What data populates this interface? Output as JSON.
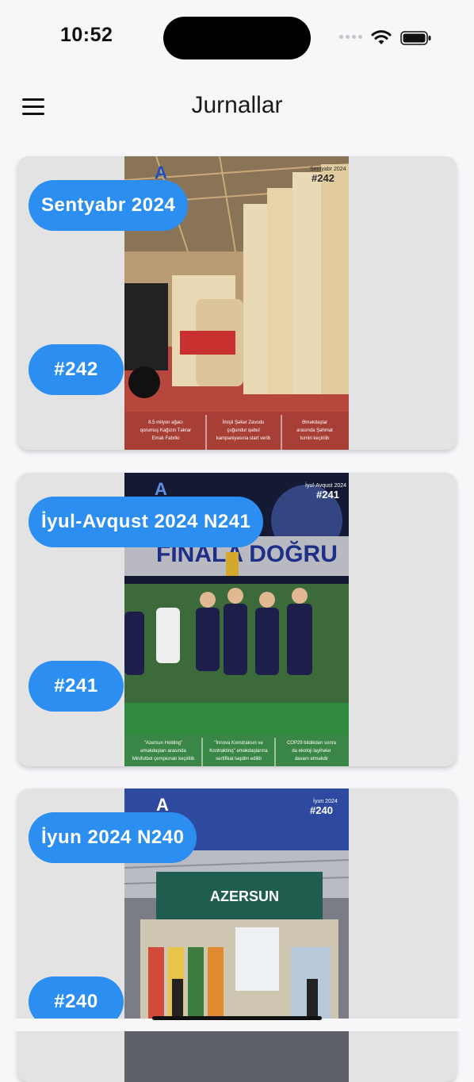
{
  "status_bar": {
    "time": "10:52"
  },
  "header": {
    "title": "Jurnallar"
  },
  "colors": {
    "accent": "#2b8ef0",
    "card_bg": "#e3e3e3",
    "page_bg": "#f7f7fa"
  },
  "issues": [
    {
      "title": "Sentyabr 2024",
      "number": "#242",
      "cover": {
        "date": "Sentyabr 2024",
        "number": "#242",
        "footer": [
          "8.5 milyon ağacı qorumuş Kağızın Təkrar Emalı Fabriki",
          "İmişli Şəkər Zavodu çuğundur qəbul kampaniyasına start verib",
          "Əməkdaşlar arasında Şahmat turniri keçirilib"
        ]
      }
    },
    {
      "title": "İyul-Avqust 2024 N241",
      "number": "#241",
      "cover": {
        "date": "İyul-Avqust 2024",
        "number": "#241",
        "headline": "FİNALA DOĞRU",
        "footer": [
          "\"Azersun Holding\" əməkdaşları arasında Minifutbol çempionatı keçirilib",
          "\"İnnova Konstraksın və Kontraktinq\" əməkdaşlarına sertifikat təqdim edilib",
          "COP29 bitdikdən sonra da ekoloji layihələr davam etməlidir"
        ]
      }
    },
    {
      "title": "İyun 2024 N240",
      "number": "#240",
      "cover": {
        "date": "İyun 2024",
        "number": "#240",
        "brand": "AZERSUN"
      }
    }
  ]
}
